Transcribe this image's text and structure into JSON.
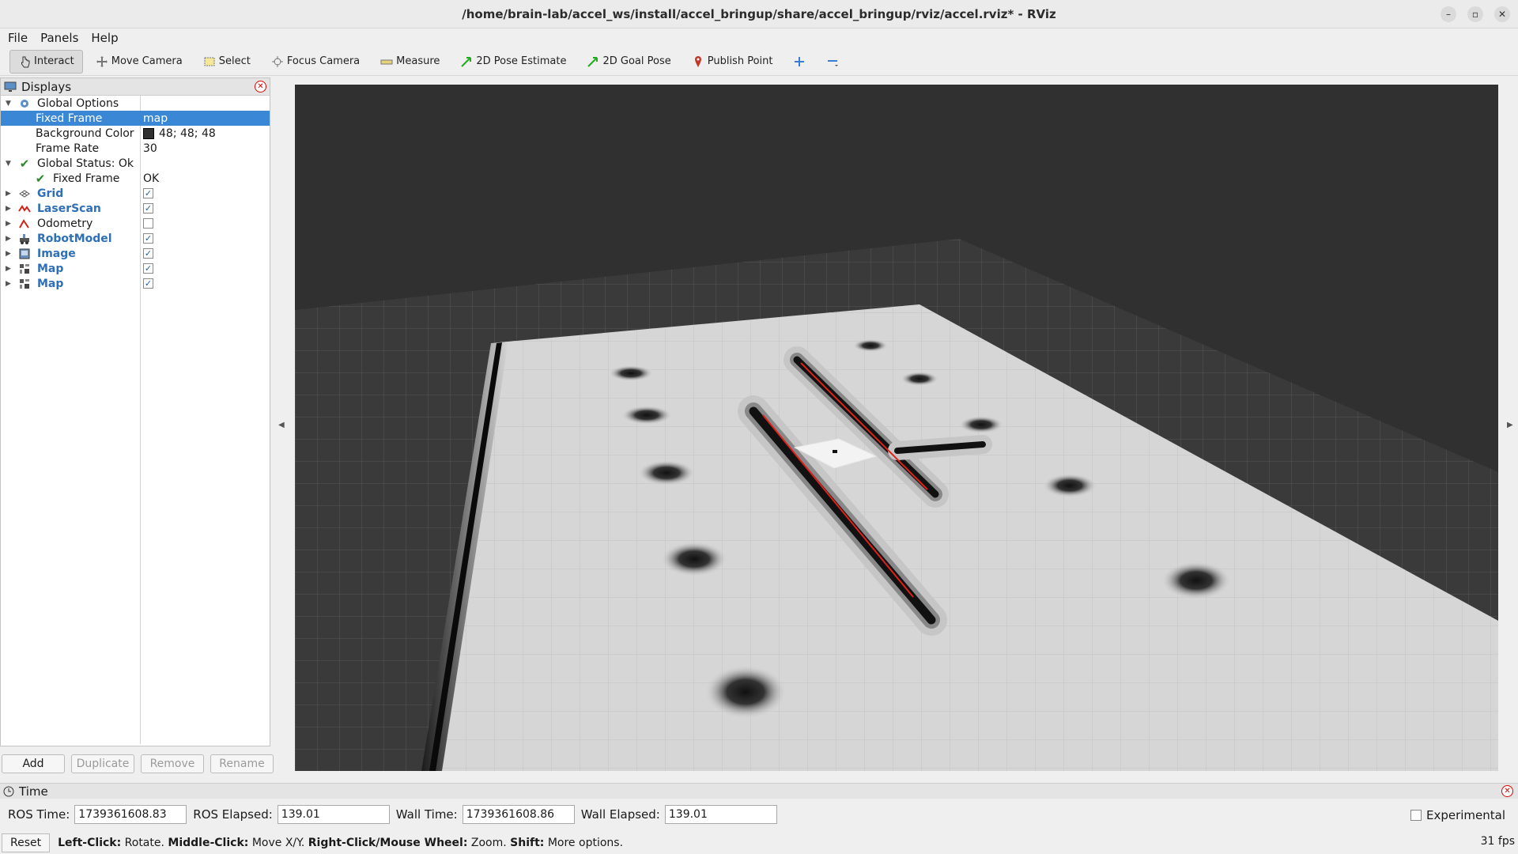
{
  "window": {
    "title": "/home/brain-lab/accel_ws/install/accel_bringup/share/accel_bringup/rviz/accel.rviz* - RViz"
  },
  "menu": {
    "file": "File",
    "panels": "Panels",
    "help": "Help"
  },
  "toolbar": {
    "interact": "Interact",
    "move_camera": "Move Camera",
    "select": "Select",
    "focus_camera": "Focus Camera",
    "measure": "Measure",
    "pose_estimate": "2D Pose Estimate",
    "goal_pose": "2D Goal Pose",
    "publish_point": "Publish Point",
    "colors": {
      "pose_arrow": "#22aa22",
      "publish_pin": "#c0392b",
      "plus": "#3a7bd5"
    }
  },
  "displays": {
    "title": "Displays",
    "global_options": "Global Options",
    "fixed_frame_label": "Fixed Frame",
    "fixed_frame_value": "map",
    "background_color_label": "Background Color",
    "background_color_value": "48; 48; 48",
    "frame_rate_label": "Frame Rate",
    "frame_rate_value": "30",
    "global_status": "Global Status: Ok",
    "status_fixed_frame_label": "Fixed Frame",
    "status_fixed_frame_value": "OK",
    "items": [
      {
        "label": "Grid",
        "checked": true,
        "icon": "grid-icon"
      },
      {
        "label": "LaserScan",
        "checked": true,
        "icon": "laserscan-icon"
      },
      {
        "label": "Odometry",
        "checked": false,
        "icon": "odometry-icon"
      },
      {
        "label": "RobotModel",
        "checked": true,
        "icon": "robotmodel-icon"
      },
      {
        "label": "Image",
        "checked": true,
        "icon": "image-icon"
      },
      {
        "label": "Map",
        "checked": true,
        "icon": "map-icon"
      },
      {
        "label": "Map",
        "checked": true,
        "icon": "map-icon"
      }
    ],
    "buttons": {
      "add": "Add",
      "duplicate": "Duplicate",
      "remove": "Remove",
      "rename": "Rename"
    },
    "colors": {
      "selection": "#3a87d6",
      "enabled_label": "#2f6fb8"
    }
  },
  "time": {
    "title": "Time",
    "ros_time_label": "ROS Time:",
    "ros_time_value": "1739361608.83",
    "ros_elapsed_label": "ROS Elapsed:",
    "ros_elapsed_value": "139.01",
    "wall_time_label": "Wall Time:",
    "wall_time_value": "1739361608.86",
    "wall_elapsed_label": "Wall Elapsed:",
    "wall_elapsed_value": "139.01",
    "experimental_label": "Experimental"
  },
  "status": {
    "reset": "Reset",
    "left_click_key": "Left-Click:",
    "left_click_text": "Rotate.",
    "middle_click_key": "Middle-Click:",
    "middle_click_text": "Move X/Y.",
    "right_click_key": "Right-Click/Mouse Wheel:",
    "right_click_text": "Zoom.",
    "shift_key": "Shift:",
    "shift_text": "More options.",
    "fps": "31 fps"
  },
  "viewport": {
    "background_color": "#303030",
    "map_free_color": "#d6d6d6",
    "laser_color": "#e0201a"
  }
}
